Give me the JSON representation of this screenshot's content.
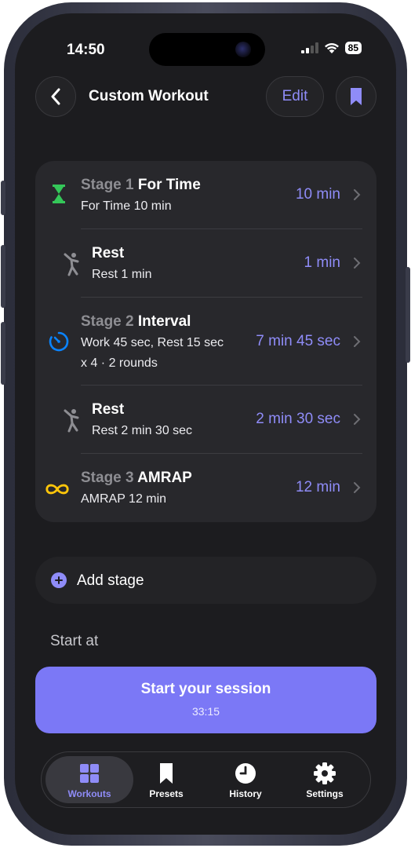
{
  "status_bar": {
    "time": "14:50",
    "battery": "85"
  },
  "header": {
    "title": "Custom Workout",
    "edit_label": "Edit"
  },
  "stages": [
    {
      "prefix": "Stage 1",
      "name": "For Time",
      "subtitle": "For Time 10 min",
      "value": "10 min",
      "icon": "hourglass-icon",
      "color": "#34c759"
    },
    {
      "prefix": "",
      "name": "Rest",
      "subtitle": "Rest 1 min",
      "value": "1 min",
      "icon": "stretch-figure-icon",
      "color": "#8e8e93"
    },
    {
      "prefix": "Stage 2",
      "name": "Interval",
      "subtitle": "Work 45 sec, Rest 15 sec x 4 · 2 rounds",
      "value": "7 min 45 sec",
      "icon": "timer-icon",
      "color": "#0a84ff"
    },
    {
      "prefix": "",
      "name": "Rest",
      "subtitle": "Rest 2 min 30 sec",
      "value": "2 min 30 sec",
      "icon": "stretch-figure-icon",
      "color": "#8e8e93"
    },
    {
      "prefix": "Stage 3",
      "name": "AMRAP",
      "subtitle": "AMRAP 12 min",
      "value": "12 min",
      "icon": "infinity-icon",
      "color": "#ffc60a"
    }
  ],
  "add_stage_label": "Add stage",
  "start_at_label": "Start at",
  "start_button": {
    "label": "Start your session",
    "duration": "33:15"
  },
  "tabs": [
    {
      "label": "Workouts",
      "icon": "grid-icon",
      "active": true
    },
    {
      "label": "Presets",
      "icon": "bookmark-icon",
      "active": false
    },
    {
      "label": "History",
      "icon": "clock-icon",
      "active": false
    },
    {
      "label": "Settings",
      "icon": "gear-icon",
      "active": false
    }
  ],
  "colors": {
    "accent": "#7b78f6",
    "accent_text": "#8f8cf8",
    "background": "#1c1c1f",
    "card": "#28282c"
  }
}
